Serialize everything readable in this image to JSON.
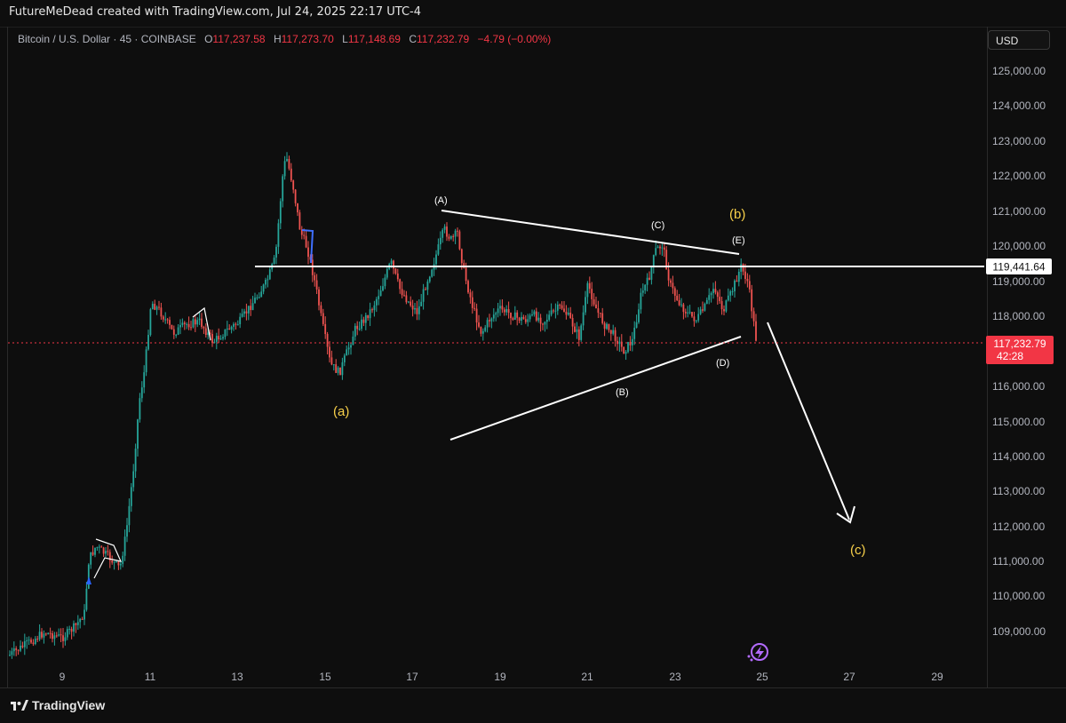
{
  "header": {
    "credit": "FutureMeDead created with TradingView.com, Jul 24, 2025 22:17 UTC-4"
  },
  "legend": {
    "symbol": "Bitcoin / U.S. Dollar · 45 · COINBASE",
    "open_label": "O",
    "open": "117,237.58",
    "high_label": "H",
    "high": "117,273.70",
    "low_label": "L",
    "low": "117,148.69",
    "close_label": "C",
    "close": "117,232.79",
    "change": "−4.79 (−0.00%)"
  },
  "currency_button": "USD",
  "price_axis": {
    "ticks": [
      "125,000.00",
      "124,000.00",
      "123,000.00",
      "122,000.00",
      "121,000.00",
      "120,000.00",
      "119,000.00",
      "118,000.00",
      "116,000.00",
      "115,000.00",
      "114,000.00",
      "113,000.00",
      "112,000.00",
      "111,000.00",
      "110,000.00",
      "109,000.00"
    ]
  },
  "time_axis": {
    "ticks": [
      "9",
      "11",
      "13",
      "15",
      "17",
      "19",
      "21",
      "23",
      "25",
      "27",
      "29"
    ]
  },
  "price_tags": {
    "resistance": "119,441.64",
    "last_price": "117,232.79",
    "countdown": "42:28"
  },
  "annotations": {
    "a_small": "(a)",
    "b_small": "(b)",
    "c_small": "(c)",
    "A": "(A)",
    "B": "(B)",
    "C": "(C)",
    "D": "(D)",
    "E": "(E)"
  },
  "colors": {
    "up": "#26a69a",
    "down": "#ef5350",
    "bg": "#0e0e0e",
    "last_price_tag": "#f23645",
    "wave_label": "#f7d04a",
    "drawing": "#ffffff"
  },
  "footer": {
    "brand": "TradingView"
  },
  "icons": [
    "tradingview-logo-icon",
    "replay-lightning-icon"
  ]
}
